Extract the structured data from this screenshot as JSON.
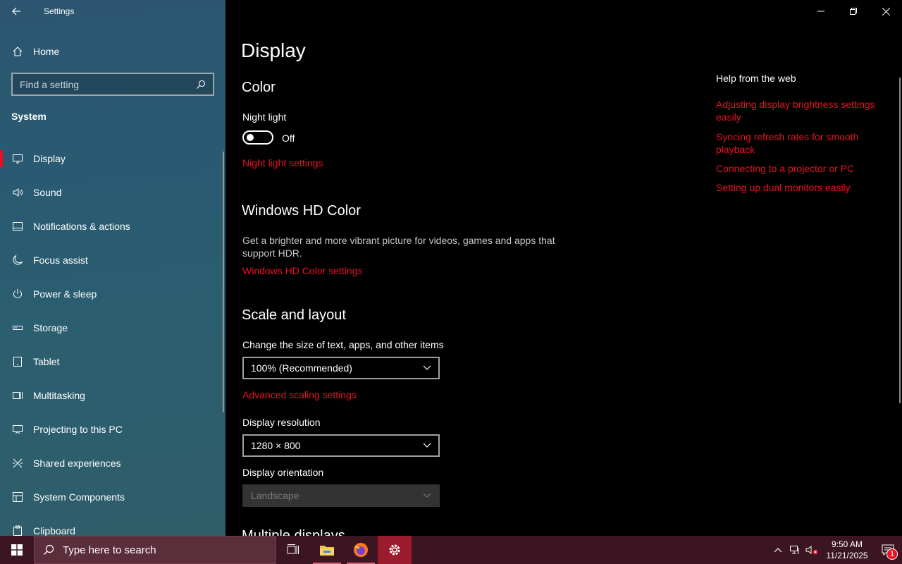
{
  "window": {
    "title": "Settings"
  },
  "sidebar": {
    "home_label": "Home",
    "search_placeholder": "Find a setting",
    "section_title": "System",
    "items": [
      {
        "label": "Display",
        "icon": "monitor-icon",
        "active": true
      },
      {
        "label": "Sound",
        "icon": "speaker-icon"
      },
      {
        "label": "Notifications & actions",
        "icon": "notification-icon"
      },
      {
        "label": "Focus assist",
        "icon": "moon-icon"
      },
      {
        "label": "Power & sleep",
        "icon": "power-icon"
      },
      {
        "label": "Storage",
        "icon": "storage-icon"
      },
      {
        "label": "Tablet",
        "icon": "tablet-icon"
      },
      {
        "label": "Multitasking",
        "icon": "multitasking-icon"
      },
      {
        "label": "Projecting to this PC",
        "icon": "projecting-icon"
      },
      {
        "label": "Shared experiences",
        "icon": "shared-icon"
      },
      {
        "label": "System Components",
        "icon": "components-icon"
      },
      {
        "label": "Clipboard",
        "icon": "clipboard-icon"
      }
    ]
  },
  "main": {
    "page_title": "Display",
    "color": {
      "heading": "Color",
      "night_light_label": "Night light",
      "night_light_state": "Off",
      "night_light_on": false,
      "night_light_settings_link": "Night light settings"
    },
    "hd_color": {
      "heading": "Windows HD Color",
      "description": "Get a brighter and more vibrant picture for videos, games and apps that support HDR.",
      "settings_link": "Windows HD Color settings"
    },
    "scale_layout": {
      "heading": "Scale and layout",
      "scale_label": "Change the size of text, apps, and other items",
      "scale_value": "100% (Recommended)",
      "advanced_link": "Advanced scaling settings",
      "resolution_label": "Display resolution",
      "resolution_value": "1280 × 800",
      "orientation_label": "Display orientation",
      "orientation_value": "Landscape"
    },
    "next_heading": "Multiple displays"
  },
  "help": {
    "title": "Help from the web",
    "links": [
      "Adjusting display brightness settings easily",
      "Syncing refresh rates for smooth playback",
      "Connecting to a projector or PC",
      "Setting up dual monitors easily"
    ]
  },
  "taskbar": {
    "search_placeholder": "Type here to search",
    "time": "9:50 AM",
    "date": "11/21/2025",
    "notification_count": "1"
  },
  "colors": {
    "accent": "#e81123",
    "taskbar": "#3b1622",
    "sidebar": "#2b5a70"
  }
}
